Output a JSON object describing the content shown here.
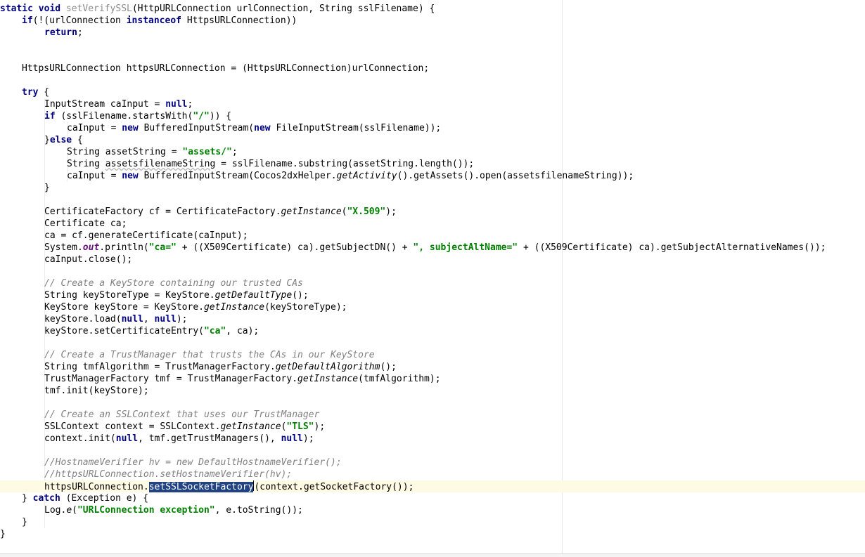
{
  "editor": {
    "lines": [
      {
        "indent": 0,
        "tokens": [
          {
            "t": "static void ",
            "c": "kw"
          },
          {
            "t": "setVerifySSL",
            "c": "gray"
          },
          {
            "t": "(HttpURLConnection urlConnection, String sslFilename) {"
          }
        ]
      },
      {
        "indent": 1,
        "tokens": [
          {
            "t": "if",
            "c": "kw"
          },
          {
            "t": "(!(urlConnection "
          },
          {
            "t": "instanceof",
            "c": "kw"
          },
          {
            "t": " HttpsURLConnection))"
          }
        ]
      },
      {
        "indent": 2,
        "tokens": [
          {
            "t": "return",
            "c": "kw"
          },
          {
            "t": ";"
          }
        ]
      },
      {
        "indent": 0,
        "tokens": []
      },
      {
        "indent": 0,
        "tokens": []
      },
      {
        "indent": 1,
        "tokens": [
          {
            "t": "HttpsURLConnection httpsURLConnection = (HttpsURLConnection)urlConnection;"
          }
        ]
      },
      {
        "indent": 0,
        "tokens": []
      },
      {
        "indent": 1,
        "tokens": [
          {
            "t": "try",
            "c": "kw"
          },
          {
            "t": " {"
          }
        ]
      },
      {
        "indent": 2,
        "tokens": [
          {
            "t": "InputStream caInput = "
          },
          {
            "t": "null",
            "c": "kw"
          },
          {
            "t": ";"
          }
        ]
      },
      {
        "indent": 2,
        "tokens": [
          {
            "t": "if",
            "c": "kw"
          },
          {
            "t": " (sslFilename.startsWith("
          },
          {
            "t": "\"/\"",
            "c": "str"
          },
          {
            "t": ")) {"
          }
        ]
      },
      {
        "indent": 3,
        "tokens": [
          {
            "t": "caInput = "
          },
          {
            "t": "new",
            "c": "kw"
          },
          {
            "t": " BufferedInputStream("
          },
          {
            "t": "new",
            "c": "kw"
          },
          {
            "t": " FileInputStream(sslFilename));"
          }
        ]
      },
      {
        "indent": 2,
        "tokens": [
          {
            "t": "}"
          },
          {
            "t": "else",
            "c": "kw"
          },
          {
            "t": " {"
          }
        ]
      },
      {
        "indent": 3,
        "tokens": [
          {
            "t": "String assetString = "
          },
          {
            "t": "\"assets/\"",
            "c": "str"
          },
          {
            "t": ";"
          }
        ]
      },
      {
        "indent": 3,
        "tokens": [
          {
            "t": "String "
          },
          {
            "t": "assetsfilenameString",
            "c": "warn"
          },
          {
            "t": " = sslFilename.substring(assetString.length());"
          }
        ]
      },
      {
        "indent": 3,
        "tokens": [
          {
            "t": "caInput = "
          },
          {
            "t": "new",
            "c": "kw"
          },
          {
            "t": " BufferedInputStream(Cocos2dxHelper."
          },
          {
            "t": "getActivity",
            "c": "it"
          },
          {
            "t": "().getAssets().open(assetsfilenameString));"
          }
        ]
      },
      {
        "indent": 2,
        "tokens": [
          {
            "t": "}"
          }
        ]
      },
      {
        "indent": 0,
        "tokens": []
      },
      {
        "indent": 2,
        "tokens": [
          {
            "t": "CertificateFactory cf = CertificateFactory."
          },
          {
            "t": "getInstance",
            "c": "it"
          },
          {
            "t": "("
          },
          {
            "t": "\"X.509\"",
            "c": "str"
          },
          {
            "t": ");"
          }
        ]
      },
      {
        "indent": 2,
        "tokens": [
          {
            "t": "Certificate ca;"
          }
        ]
      },
      {
        "indent": 2,
        "tokens": [
          {
            "t": "ca = cf.generateCertificate(caInput);"
          }
        ]
      },
      {
        "indent": 2,
        "tokens": [
          {
            "t": "System."
          },
          {
            "t": "out",
            "c": "fld"
          },
          {
            "t": ".println("
          },
          {
            "t": "\"ca=\"",
            "c": "str"
          },
          {
            "t": " + ((X509Certificate) ca).getSubjectDN() + "
          },
          {
            "t": "\", subjectAltName=\"",
            "c": "str"
          },
          {
            "t": " + ((X509Certificate) ca).getSubjectAlternativeNames());"
          }
        ]
      },
      {
        "indent": 2,
        "tokens": [
          {
            "t": "caInput.close();"
          }
        ]
      },
      {
        "indent": 0,
        "tokens": []
      },
      {
        "indent": 2,
        "tokens": [
          {
            "t": "// Create a KeyStore containing our trusted CAs",
            "c": "cmt"
          }
        ]
      },
      {
        "indent": 2,
        "tokens": [
          {
            "t": "String keyStoreType = KeyStore."
          },
          {
            "t": "getDefaultType",
            "c": "it"
          },
          {
            "t": "();"
          }
        ]
      },
      {
        "indent": 2,
        "tokens": [
          {
            "t": "KeyStore keyStore = KeyStore."
          },
          {
            "t": "getInstance",
            "c": "it"
          },
          {
            "t": "(keyStoreType);"
          }
        ]
      },
      {
        "indent": 2,
        "tokens": [
          {
            "t": "keyStore.load("
          },
          {
            "t": "null",
            "c": "kw"
          },
          {
            "t": ", "
          },
          {
            "t": "null",
            "c": "kw"
          },
          {
            "t": ");"
          }
        ]
      },
      {
        "indent": 2,
        "tokens": [
          {
            "t": "keyStore.setCertificateEntry("
          },
          {
            "t": "\"ca\"",
            "c": "str"
          },
          {
            "t": ", ca);"
          }
        ]
      },
      {
        "indent": 0,
        "tokens": []
      },
      {
        "indent": 2,
        "tokens": [
          {
            "t": "// Create a TrustManager that trusts the CAs in our KeyStore",
            "c": "cmt"
          }
        ]
      },
      {
        "indent": 2,
        "tokens": [
          {
            "t": "String tmfAlgorithm = TrustManagerFactory."
          },
          {
            "t": "getDefaultAlgorithm",
            "c": "it"
          },
          {
            "t": "();"
          }
        ]
      },
      {
        "indent": 2,
        "tokens": [
          {
            "t": "TrustManagerFactory tmf = TrustManagerFactory."
          },
          {
            "t": "getInstance",
            "c": "it"
          },
          {
            "t": "(tmfAlgorithm);"
          }
        ]
      },
      {
        "indent": 2,
        "tokens": [
          {
            "t": "tmf.init(keyStore);"
          }
        ]
      },
      {
        "indent": 0,
        "tokens": []
      },
      {
        "indent": 2,
        "tokens": [
          {
            "t": "// Create an SSLContext that uses our TrustManager",
            "c": "cmt"
          }
        ]
      },
      {
        "indent": 2,
        "tokens": [
          {
            "t": "SSLContext context = SSLContext."
          },
          {
            "t": "getInstance",
            "c": "it"
          },
          {
            "t": "("
          },
          {
            "t": "\"TLS\"",
            "c": "str"
          },
          {
            "t": ");"
          }
        ]
      },
      {
        "indent": 2,
        "tokens": [
          {
            "t": "context.init("
          },
          {
            "t": "null",
            "c": "kw"
          },
          {
            "t": ", tmf.getTrustManagers(), "
          },
          {
            "t": "null",
            "c": "kw"
          },
          {
            "t": ");"
          }
        ]
      },
      {
        "indent": 0,
        "tokens": []
      },
      {
        "indent": 2,
        "tokens": [
          {
            "t": "//HostnameVerifier hv = new DefaultHostnameVerifier();",
            "c": "cmt"
          }
        ]
      },
      {
        "indent": 2,
        "tokens": [
          {
            "t": "//httpsURLConnection.setHostnameVerifier(hv);",
            "c": "cmt"
          }
        ]
      },
      {
        "indent": 2,
        "current": true,
        "tokens": [
          {
            "t": "httpsURLConnection."
          },
          {
            "t": "setSSLSocketFactory",
            "c": "sel"
          },
          {
            "t": "",
            "c": "caret"
          },
          {
            "t": "(context.getSocketFactory());"
          }
        ]
      },
      {
        "indent": 1,
        "tokens": [
          {
            "t": "} "
          },
          {
            "t": "catch",
            "c": "kw"
          },
          {
            "t": " (Exception e) {"
          }
        ]
      },
      {
        "indent": 2,
        "tokens": [
          {
            "t": "Log."
          },
          {
            "t": "e",
            "c": "it"
          },
          {
            "t": "("
          },
          {
            "t": "\"URLConnection exception\"",
            "c": "str"
          },
          {
            "t": ", e.toString());"
          }
        ]
      },
      {
        "indent": 1,
        "tokens": [
          {
            "t": "}"
          }
        ]
      },
      {
        "indent": 0,
        "tokens": [
          {
            "t": "}"
          }
        ]
      }
    ]
  }
}
